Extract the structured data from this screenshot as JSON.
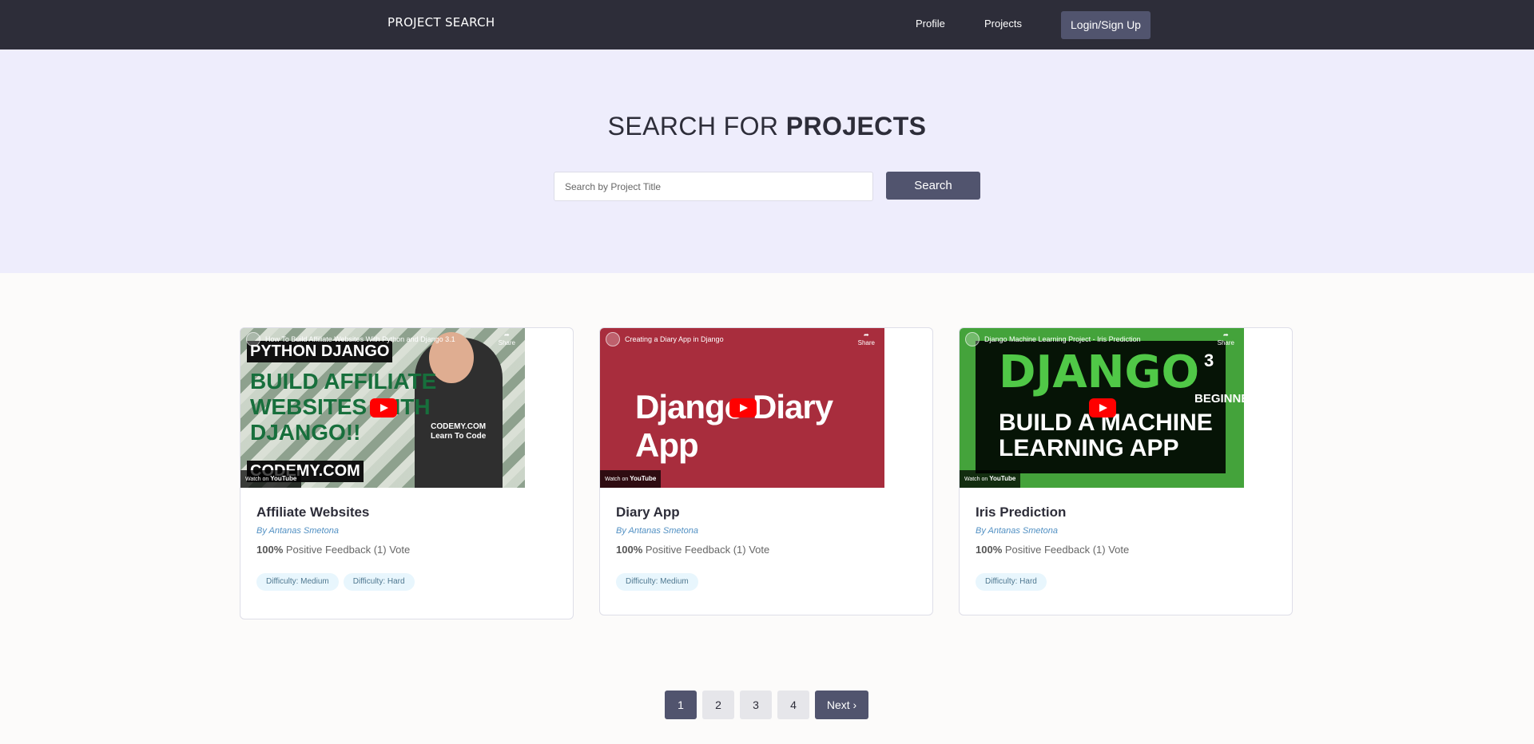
{
  "navbar": {
    "brand": "PROJECT SEARCH",
    "links": [
      {
        "label": "Profile"
      },
      {
        "label": "Projects"
      }
    ],
    "login_label": "Login/Sign Up"
  },
  "hero": {
    "title_prefix": "SEARCH FOR ",
    "title_bold": "PROJECTS",
    "search_placeholder": "Search by Project Title",
    "search_button": "Search"
  },
  "projects": [
    {
      "title": "Affiliate Websites",
      "author": "By Antanas Smetona",
      "feedback_percent": "100%",
      "feedback_text": " Positive Feedback (1) Vote",
      "tags": [
        "Difficulty: Medium",
        "Difficulty: Hard"
      ],
      "video": {
        "heading": "How To Build Affiliate Websites With Python and Django 3.1",
        "thumb_line1": "PYTHON DJANGO",
        "thumb_line2": "BUILD AFFILIATE",
        "thumb_line3": "WEBSITES WITH",
        "thumb_line4": "DJANGO!!",
        "thumb_line5": "CODEMY.COM",
        "shirt_line1": "CODEMY.COM",
        "shirt_line2": "Learn To Code",
        "share": "Share",
        "watch_on": "Watch on",
        "youtube": "YouTube"
      }
    },
    {
      "title": "Diary App",
      "author": "By Antanas Smetona",
      "feedback_percent": "100%",
      "feedback_text": " Positive Feedback (1) Vote",
      "tags": [
        "Difficulty: Medium"
      ],
      "video": {
        "heading": "Creating a Diary App in Django",
        "thumb_title": "Django Diary App",
        "share": "Share",
        "watch_on": "Watch on",
        "youtube": "YouTube"
      }
    },
    {
      "title": "Iris Prediction",
      "author": "By Antanas Smetona",
      "feedback_percent": "100%",
      "feedback_text": " Positive Feedback (1) Vote",
      "tags": [
        "Difficulty: Hard"
      ],
      "video": {
        "heading": "Django Machine Learning Project - Iris Prediction",
        "thumb_main": "DJANGO",
        "thumb_version": "3",
        "thumb_level": "BEGINNER",
        "thumb_line1": "BUILD A MACHINE",
        "thumb_line2": "LEARNING APP",
        "share": "Share",
        "watch_on": "Watch on",
        "youtube": "YouTube"
      }
    }
  ],
  "pagination": {
    "pages": [
      "1",
      "2",
      "3",
      "4"
    ],
    "active_page": "1",
    "next_label": "Next ›"
  },
  "colors": {
    "navbar": "#2d2d39",
    "hero_bg": "#eeedfc",
    "primary_button": "#51546e",
    "author_link": "#5190c3",
    "tag_bg": "#e8f6fd"
  }
}
